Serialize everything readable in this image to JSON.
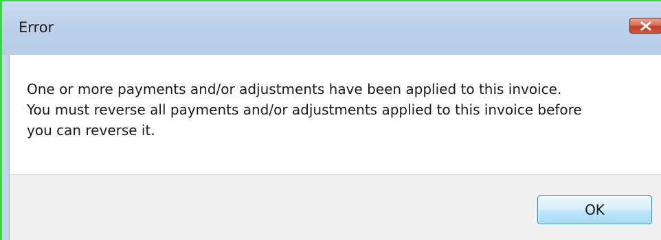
{
  "dialog": {
    "title": "Error",
    "message_lines": [
      "One or more payments and/or adjustments have been applied to this invoice.",
      "You must reverse all payments and/or adjustments applied to this invoice before",
      "you can reverse it."
    ],
    "ok_label": "OK",
    "close_icon": "close-x-icon"
  },
  "colors": {
    "titlebar": "#bcd0ea",
    "close_button": "#c2402b",
    "button_area": "#f0f0f0",
    "ok_button_border": "#3c7fb1",
    "window_highlight": "#3fd24a"
  }
}
